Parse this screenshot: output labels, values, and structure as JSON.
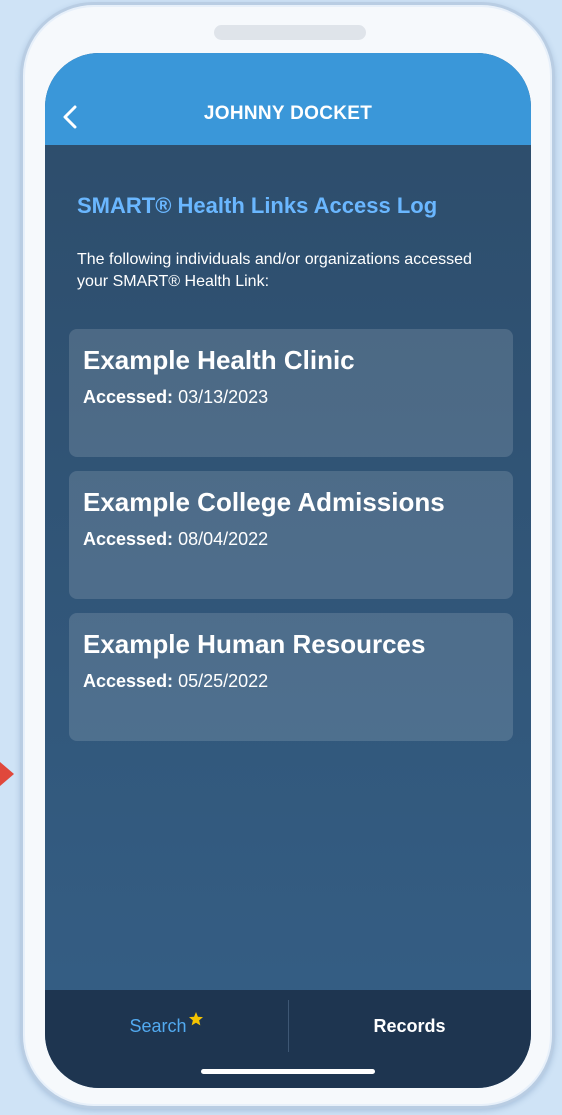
{
  "header": {
    "title": "JOHNNY DOCKET"
  },
  "access_log": {
    "title": "SMART® Health Links Access Log",
    "description": "The following individuals and/or organizations accessed your SMART® Health Link:",
    "entries": [
      {
        "name": "Example Health Clinic",
        "accessed_label": "Accessed:",
        "accessed_date": "03/13/2023"
      },
      {
        "name": "Example College Admissions",
        "accessed_label": "Accessed:",
        "accessed_date": "08/04/2022"
      },
      {
        "name": "Example Human Resources",
        "accessed_label": "Accessed:",
        "accessed_date": "05/25/2022"
      }
    ]
  },
  "tabbar": {
    "search_label": "Search",
    "records_label": "Records"
  },
  "colors": {
    "header_bg": "#3a97d9",
    "screen_bg": "#2d4c6a",
    "accent_blue": "#6ab7ff",
    "tabbar_bg": "#1e3550",
    "star": "#f5c400"
  },
  "icons": {
    "back": "chevron-left-icon",
    "search_badge": "star-icon"
  }
}
